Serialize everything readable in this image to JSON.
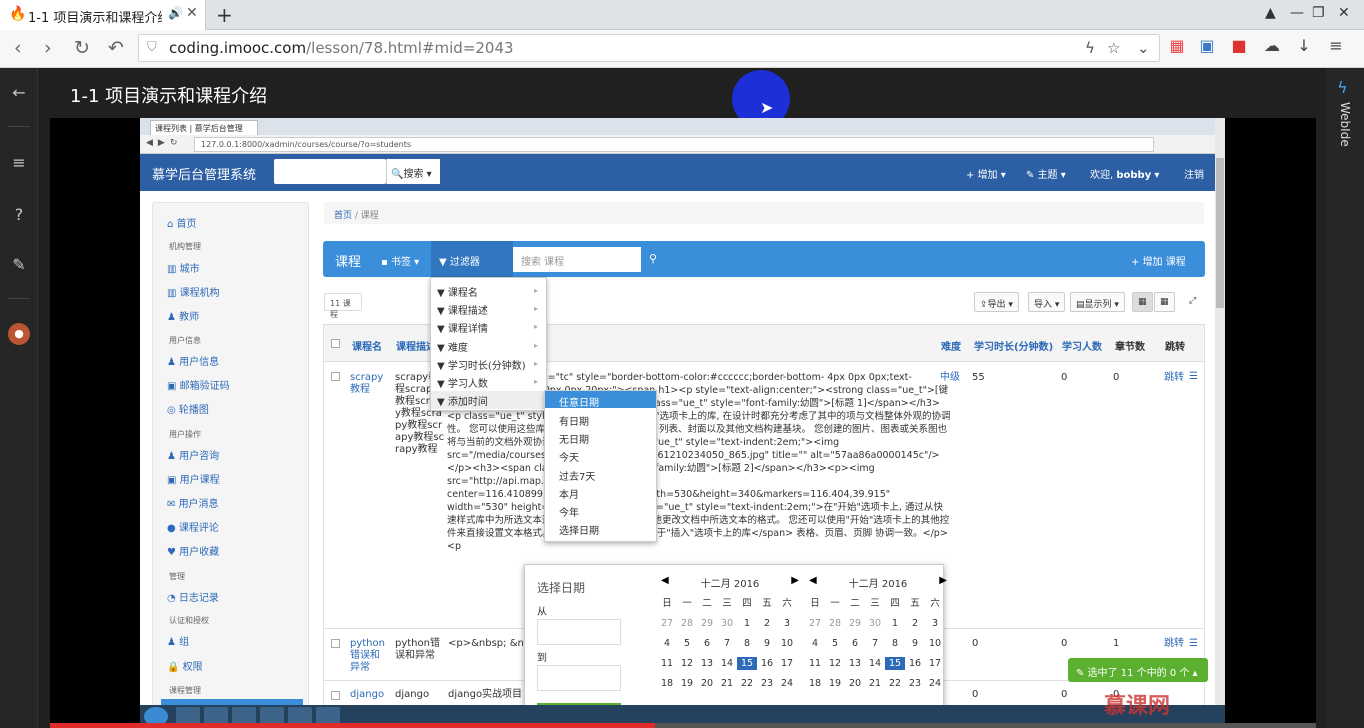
{
  "browser": {
    "tab_title": "1-1 项目演示和课程介绍",
    "url_host": "coding.imooc.com",
    "url_path": "/lesson/78.html#mid=2043"
  },
  "rail": {
    "right_label": "WebIde"
  },
  "lesson": {
    "title": "1-1 项目演示和课程介绍"
  },
  "inner": {
    "tab_title": "课程列表 | 慕学后台管理",
    "url": "127.0.0.1:8000/xadmin/courses/course/?o=students",
    "nav": {
      "brand": "慕学后台管理系统",
      "search_btn": "搜索",
      "add": "增加",
      "theme": "主题",
      "welcome": "欢迎,",
      "user": "bobby",
      "logout": "注销"
    },
    "sidebar": {
      "home": "首页",
      "groups": [
        {
          "title": "机构管理",
          "items": [
            "城市",
            "课程机构",
            "教师"
          ]
        },
        {
          "title": "用户信息",
          "items": [
            "用户信息",
            "邮箱验证码",
            "轮播图"
          ]
        },
        {
          "title": "用户操作",
          "items": [
            "用户咨询",
            "用户课程",
            "用户消息",
            "课程评论",
            "用户收藏"
          ]
        },
        {
          "title": "管理",
          "items": [
            "日志记录"
          ]
        },
        {
          "title": "认证和授权",
          "items": [
            "组",
            "权限"
          ]
        },
        {
          "title": "课程管理",
          "items": []
        }
      ]
    },
    "breadcrumb": {
      "home": "首页",
      "current": "课程"
    },
    "panel": {
      "title": "课程",
      "bookmark": "书签",
      "filter": "过滤器",
      "search_placeholder": "搜索 课程",
      "add": "增加 课程"
    },
    "toolbar": {
      "count": "11 课程",
      "export": "导出",
      "import": "导入",
      "columns": "显示列"
    },
    "table": {
      "headers": [
        "课程名",
        "课程描述",
        "难度",
        "学习时长(分钟数)",
        "学习人数",
        "章节数",
        "跳转"
      ],
      "rows": [
        {
          "name": "scrapy教程",
          "desc": "scrapy教程scrapy教程scrapy教程scrapy教程scrapy教程scrapy教程",
          "level": "中级",
          "minutes": "55",
          "students": "0",
          "chapters": "0",
          "jump": "跳转"
        },
        {
          "name": "python错误和异常",
          "desc": "python错误和异常",
          "detail": "<p>&nbsp; &nbsp;",
          "level": "中级",
          "minutes": "0",
          "students": "0",
          "chapters": "1",
          "jump": "跳转"
        },
        {
          "name": "django",
          "desc": "django",
          "detail": "django实战项目 d",
          "level": "",
          "minutes": "0",
          "students": "0",
          "chapters": "0",
          "jump": ""
        }
      ],
      "html_snippet": "=\"Title center\" name=\"tc\" style=\"border-bottom-color:#cccccc;border-bottom- 4px 0px 0px;text-align:center;margin:0px 0px 20px;\"><span h1><p style=\"text-align:center;\"><strong class=\"ue_t\">[键入 文档副标题]</strong></p><h3><span class=\"ue_t\" style=\"font-family:幼圆\">[标题 1]</span></h3><p class=\"ue_t\" style=\"text-indent:2em;\">\"选项卡上的库, 在设计时都充分考虑了其中的项与文档整体外观的协调性。 您可以使用这些库来插入表格、页眉、页脚、列表、封面以及其他文档构建基块。 您创建的图片、图表或关系图也将与当前的文档外观协调一致。</p><p class=\"ue_t\" style=\"text-indent:2em;\"><img src=\"/media/courses/ueditor/12000460_20161210234050_865.jpg\" title=\"\" alt=\"57aa86a0000145c\"/></p><h3><span class=\"ue_t\" style=\"font-family:幼圆\">[标题 2]</span></h3><p><img src=\"http://api.map.baidu.com/staticimage?center=116.410899,39.915&zoom=11&width=530&height=340&markers=116.404,39.915\" width=\"530\" height=\"340\"/> </p><p class=\"ue_t\" style=\"text-indent:2em;\">在\"开始\"选项卡上, 通过从快速样式库中为所选文本选择一种外观, 您可以方便地更改文档中所选文本的格式。 您还可以使用\"开始\"选项卡上的其他控件来直接设置文本格式。 <span class=\"ue_t\">于\"插入\"选项卡上的库</span> 表格、页眉、页脚 协调一致。</p><p"
    },
    "filter_menu": {
      "items": [
        "课程名",
        "课程描述",
        "课程详情",
        "难度",
        "学习时长(分钟数)",
        "学习人数",
        "添加时间"
      ],
      "sub_items": [
        "任意日期",
        "有日期",
        "无日期",
        "今天",
        "过去7天",
        "本月",
        "今年",
        "选择日期"
      ]
    },
    "datepicker": {
      "label": "选择日期",
      "from": "从",
      "to": "到",
      "month_left": "十二月 2016",
      "month_right": "十二月 2016",
      "weekdays": [
        "日",
        "一",
        "二",
        "三",
        "四",
        "五",
        "六"
      ],
      "days": [
        "27",
        "28",
        "29",
        "30",
        "1",
        "2",
        "3",
        "4",
        "5",
        "6",
        "7",
        "8",
        "9",
        "10",
        "11",
        "12",
        "13",
        "14",
        "15",
        "16",
        "17",
        "18",
        "19",
        "20",
        "21",
        "22",
        "23",
        "24"
      ],
      "selected": "15"
    },
    "selection_badge": "选中了 11 个中的 0 个"
  },
  "watermark": "慕课网"
}
